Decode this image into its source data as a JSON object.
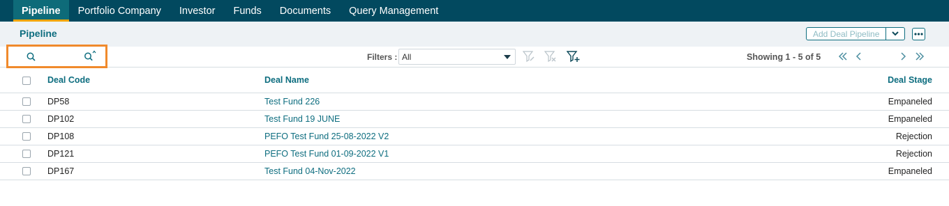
{
  "nav": {
    "items": [
      {
        "label": "Pipeline",
        "active": true
      },
      {
        "label": "Portfolio Company",
        "active": false
      },
      {
        "label": "Investor",
        "active": false
      },
      {
        "label": "Funds",
        "active": false
      },
      {
        "label": "Documents",
        "active": false
      },
      {
        "label": "Query Management",
        "active": false
      }
    ]
  },
  "page": {
    "title": "Pipeline",
    "add_button_label": "Add Deal Pipeline"
  },
  "toolbar": {
    "filters_label": "Filters :",
    "filter_value": "All",
    "showing_text": "Showing 1 - 5 of 5"
  },
  "table": {
    "headers": {
      "code": "Deal Code",
      "name": "Deal Name",
      "stage": "Deal Stage"
    },
    "rows": [
      {
        "code": "DP58",
        "name": "Test Fund 226",
        "stage": "Empaneled"
      },
      {
        "code": "DP102",
        "name": "Test Fund 19 JUNE",
        "stage": "Empaneled"
      },
      {
        "code": "DP108",
        "name": "PEFO Test Fund 25-08-2022 V2",
        "stage": "Rejection"
      },
      {
        "code": "DP121",
        "name": "PEFO Test Fund 01-09-2022 V1",
        "stage": "Rejection"
      },
      {
        "code": "DP167",
        "name": "Test Fund 04-Nov-2022",
        "stage": "Empaneled"
      }
    ]
  },
  "colors": {
    "nav_bg": "#02495f",
    "accent": "#0d6d7f",
    "active_underline": "#f0a500",
    "highlight_box": "#f08a2c"
  }
}
